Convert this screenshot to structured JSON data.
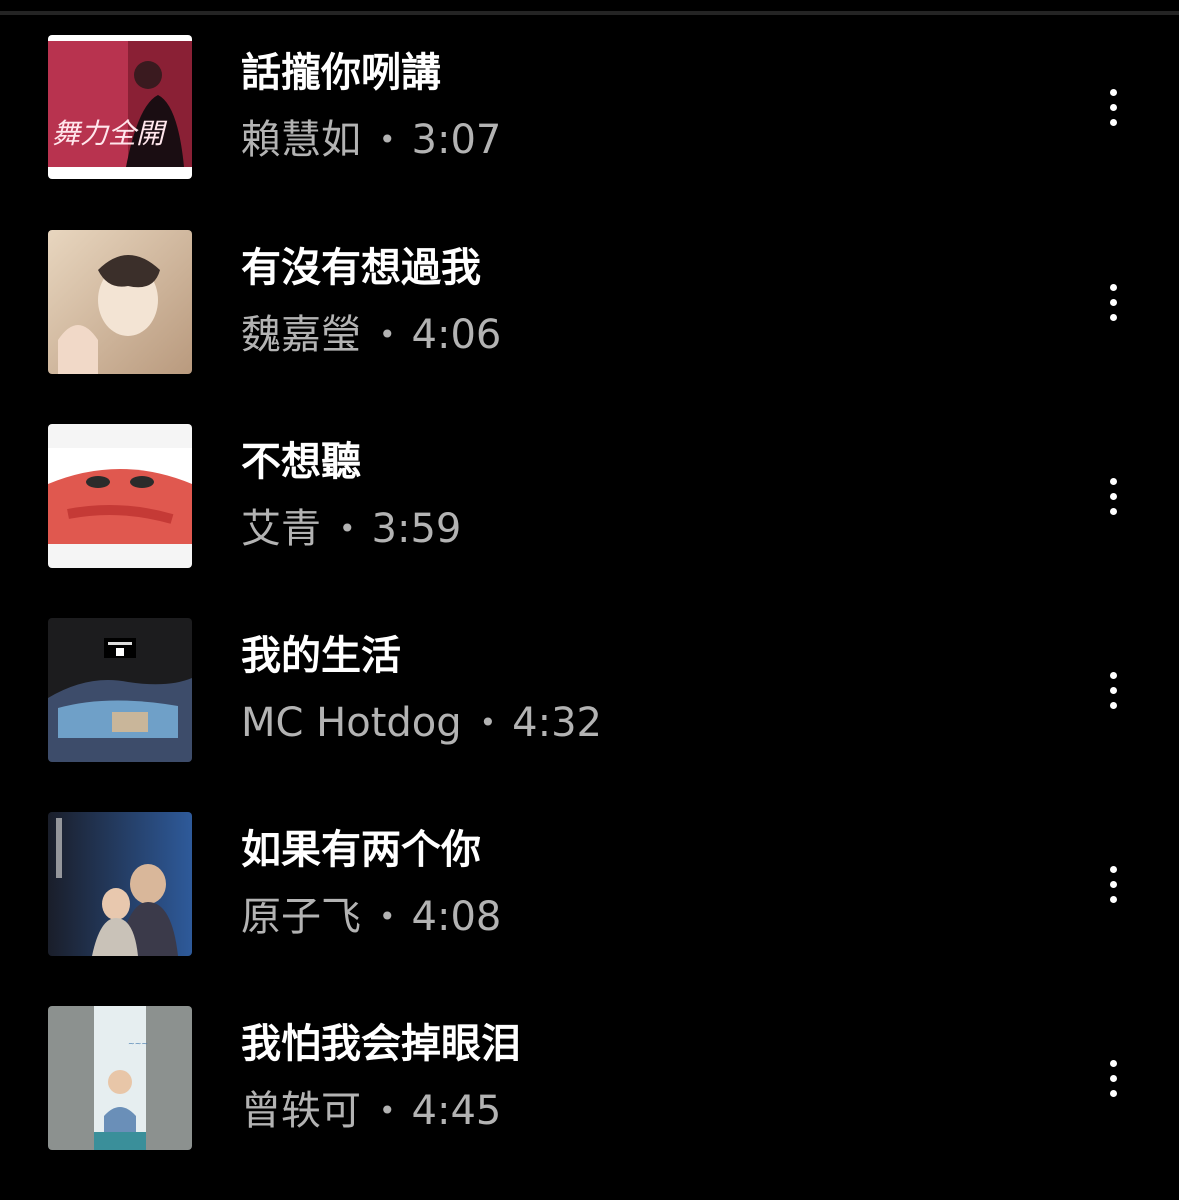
{
  "songs": [
    {
      "title": "話攏你咧講",
      "artist": "賴慧如",
      "duration": "3:07",
      "separator": "•",
      "cover_text": "舞力全開",
      "more_icon": "more-vertical-icon"
    },
    {
      "title": "有沒有想過我",
      "artist": "魏嘉瑩",
      "duration": "4:06",
      "separator": "•",
      "cover_text": "",
      "more_icon": "more-vertical-icon"
    },
    {
      "title": "不想聽",
      "artist": "艾青",
      "duration": "3:59",
      "separator": "•",
      "cover_text": "",
      "more_icon": "more-vertical-icon"
    },
    {
      "title": "我的生活",
      "artist": "MC Hotdog",
      "duration": "4:32",
      "separator": "•",
      "cover_text": "",
      "more_icon": "more-vertical-icon"
    },
    {
      "title": "如果有两个你",
      "artist": "原子飞",
      "duration": "4:08",
      "separator": "•",
      "cover_text": "",
      "more_icon": "more-vertical-icon"
    },
    {
      "title": "我怕我会掉眼泪",
      "artist": "曾轶可",
      "duration": "4:45",
      "separator": "•",
      "cover_text": "",
      "more_icon": "more-vertical-icon"
    }
  ],
  "colors": {
    "background": "#000000",
    "title": "#ffffff",
    "subtitle": "#b3b3b3"
  }
}
